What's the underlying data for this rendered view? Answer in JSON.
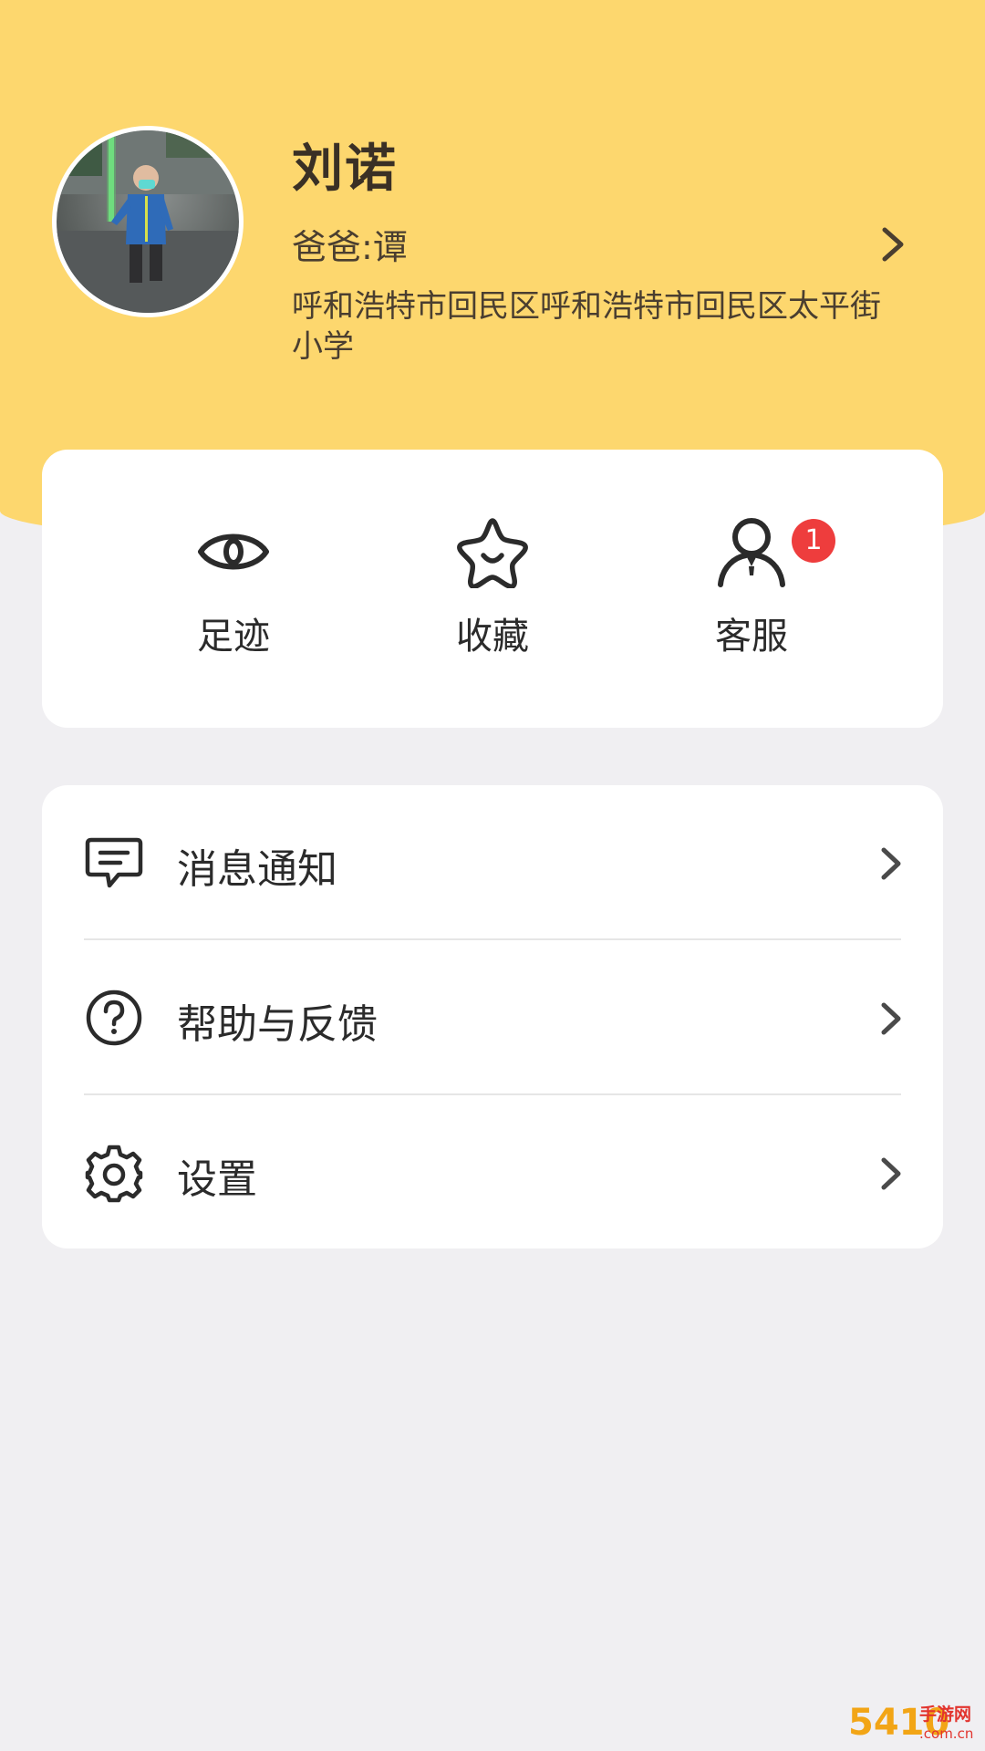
{
  "profile": {
    "name": "刘诺",
    "parent": "爸爸:谭",
    "school": "呼和浩特市回民区呼和浩特市回民区太平街小学"
  },
  "quick_actions": [
    {
      "label": "足迹",
      "icon": "eye-icon"
    },
    {
      "label": "收藏",
      "icon": "star-icon"
    },
    {
      "label": "客服",
      "icon": "customer-service-icon",
      "badge": "1"
    }
  ],
  "menu": [
    {
      "label": "消息通知",
      "icon": "message-icon"
    },
    {
      "label": "帮助与反馈",
      "icon": "help-icon"
    },
    {
      "label": "设置",
      "icon": "gear-icon"
    }
  ],
  "watermark": {
    "number": "5410",
    "text": "手游网",
    "sub": ".com.cn"
  },
  "colors": {
    "header": "#fdd76e",
    "background": "#f0eff2",
    "badge": "#ee3d3d",
    "card": "#ffffff"
  }
}
